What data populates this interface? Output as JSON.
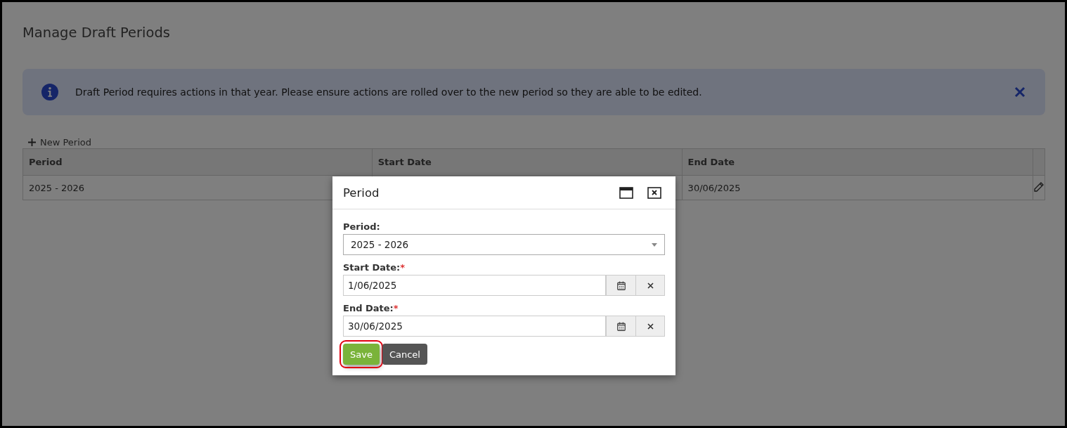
{
  "page": {
    "title": "Manage Draft Periods"
  },
  "info_banner": {
    "message": "Draft Period requires actions in that year. Please ensure actions are rolled over to the new period so they are able to be edited."
  },
  "toolbar": {
    "new_button": "New Period"
  },
  "table": {
    "columns": [
      "Period",
      "Start Date",
      "End Date"
    ],
    "rows": [
      {
        "period": "2025 - 2026",
        "end_date": "30/06/2025"
      }
    ]
  },
  "dialog": {
    "title": "Period",
    "fields": [
      {
        "kind": "select",
        "label": "Period:",
        "value": "2025 - 2026"
      },
      {
        "kind": "date",
        "label": "Start Date:",
        "required_mark": "*",
        "value": "1/06/2025"
      },
      {
        "kind": "date",
        "label": "End Date:",
        "required_mark": "*",
        "value": "30/06/2025"
      }
    ],
    "buttons": [
      {
        "label": "Save",
        "kind": "primary",
        "highlighted": true
      },
      {
        "label": "Cancel",
        "kind": "secondary",
        "highlighted": false
      }
    ]
  }
}
